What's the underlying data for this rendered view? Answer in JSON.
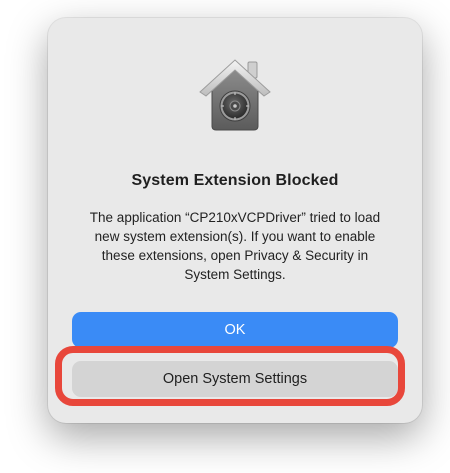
{
  "dialog": {
    "title": "System Extension Blocked",
    "message": "The application “CP210xVCPDriver” tried to load new system extension(s). If you want to enable these extensions, open Privacy & Security in System Settings.",
    "icon": "security-house-lock-icon"
  },
  "buttons": {
    "ok_label": "OK",
    "open_settings_label": "Open System Settings"
  },
  "annotation": {
    "highlight_color": "#e8473b"
  },
  "colors": {
    "primary_button": "#3a8bf6",
    "secondary_button": "#d4d4d4",
    "dialog_background": "#e9e9e9"
  }
}
